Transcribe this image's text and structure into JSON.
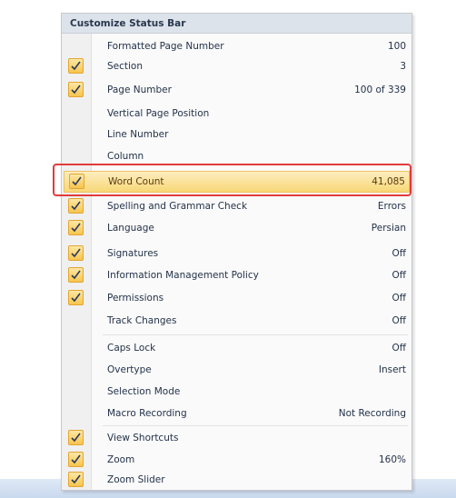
{
  "menu": {
    "title": "Customize Status Bar",
    "items": [
      {
        "label": "Formatted Page Number",
        "value": "100",
        "checked": false
      },
      {
        "label": "Section",
        "value": "3",
        "checked": true
      },
      {
        "label": "Page Number",
        "value": "100 of 339",
        "checked": true
      },
      {
        "label": "Vertical Page Position",
        "value": "",
        "checked": false
      },
      {
        "label": "Line Number",
        "value": "",
        "checked": false
      },
      {
        "label": "Column",
        "value": "",
        "checked": false
      },
      {
        "label": "Word Count",
        "value": "41,085",
        "checked": true
      },
      {
        "label": "Spelling and Grammar Check",
        "value": "Errors",
        "checked": true
      },
      {
        "label": "Language",
        "value": "Persian",
        "checked": true
      },
      {
        "label": "Signatures",
        "value": "Off",
        "checked": true
      },
      {
        "label": "Information Management Policy",
        "value": "Off",
        "checked": true
      },
      {
        "label": "Permissions",
        "value": "Off",
        "checked": true
      },
      {
        "label": "Track Changes",
        "value": "Off",
        "checked": false
      },
      {
        "label": "Caps Lock",
        "value": "Off",
        "checked": false
      },
      {
        "label": "Overtype",
        "value": "Insert",
        "checked": false
      },
      {
        "label": "Selection Mode",
        "value": "",
        "checked": false
      },
      {
        "label": "Macro Recording",
        "value": "Not Recording",
        "checked": false
      },
      {
        "label": "View Shortcuts",
        "value": "",
        "checked": true
      },
      {
        "label": "Zoom",
        "value": "160%",
        "checked": true
      },
      {
        "label": "Zoom Slider",
        "value": "",
        "checked": true
      }
    ]
  },
  "highlight": {
    "item": "Word Count",
    "color": "#e23b3b"
  },
  "colors": {
    "check_fill": "#f6c54d",
    "menu_bg": "#fafafa",
    "header_bg": "#dde3ea"
  }
}
